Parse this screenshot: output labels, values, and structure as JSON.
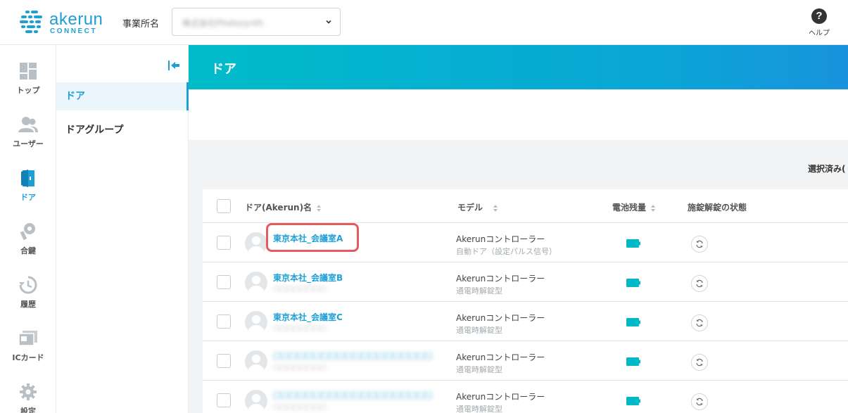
{
  "header": {
    "logo_text": "akerun",
    "logo_sub": "CONNECT",
    "office_label": "事業所名",
    "office_value": "株式会社Photosynth",
    "help_label": "ヘルプ",
    "help_glyph": "?"
  },
  "rail": {
    "items": [
      {
        "label": "トップ",
        "icon": "dashboard-icon"
      },
      {
        "label": "ユーザー",
        "icon": "users-icon"
      },
      {
        "label": "ドア",
        "icon": "door-icon",
        "active": true
      },
      {
        "label": "合鍵",
        "icon": "key-icon"
      },
      {
        "label": "履歴",
        "icon": "history-icon"
      },
      {
        "label": "ICカード",
        "icon": "ic-card-icon"
      },
      {
        "label": "設定",
        "icon": "gear-icon"
      }
    ]
  },
  "subnav": {
    "items": [
      {
        "label": "ドア",
        "active": true
      },
      {
        "label": "ドアグループ"
      }
    ]
  },
  "main": {
    "title": "ドア",
    "selected_label": "選択済み("
  },
  "table": {
    "headers": [
      "ドア(Akerun)名",
      "モデル",
      "電池残量",
      "施錠解錠の状態"
    ],
    "rows": [
      {
        "name": "東京本社_会議室A",
        "sub": "",
        "model": "Akerunコントローラー",
        "model_sub": "自動ドア（設定パルス信号）"
      },
      {
        "name": "東京本社_会議室B",
        "sub": "□□□□□□□□",
        "model": "Akerunコントローラー",
        "model_sub": "通電時解錠型"
      },
      {
        "name": "東京本社_会議室C",
        "sub": "□□□□□□□□",
        "model": "Akerunコントローラー",
        "model_sub": "通電時解錠型"
      },
      {
        "name": "□□□□□□□□□□□□□□□□□□□□",
        "sub": "□□□□□□□□",
        "model": "Akerunコントローラー",
        "model_sub": "通電時解錠型"
      },
      {
        "name": "□□□□□□□□□□□□□□□□□□□□",
        "sub": "□□□□□□□□",
        "model": "Akerunコントローラー",
        "model_sub": "通電時解錠型"
      }
    ]
  },
  "colors": {
    "accent": "#1e9fd6",
    "battery": "#00b8c8",
    "highlight": "#e65a5e"
  }
}
